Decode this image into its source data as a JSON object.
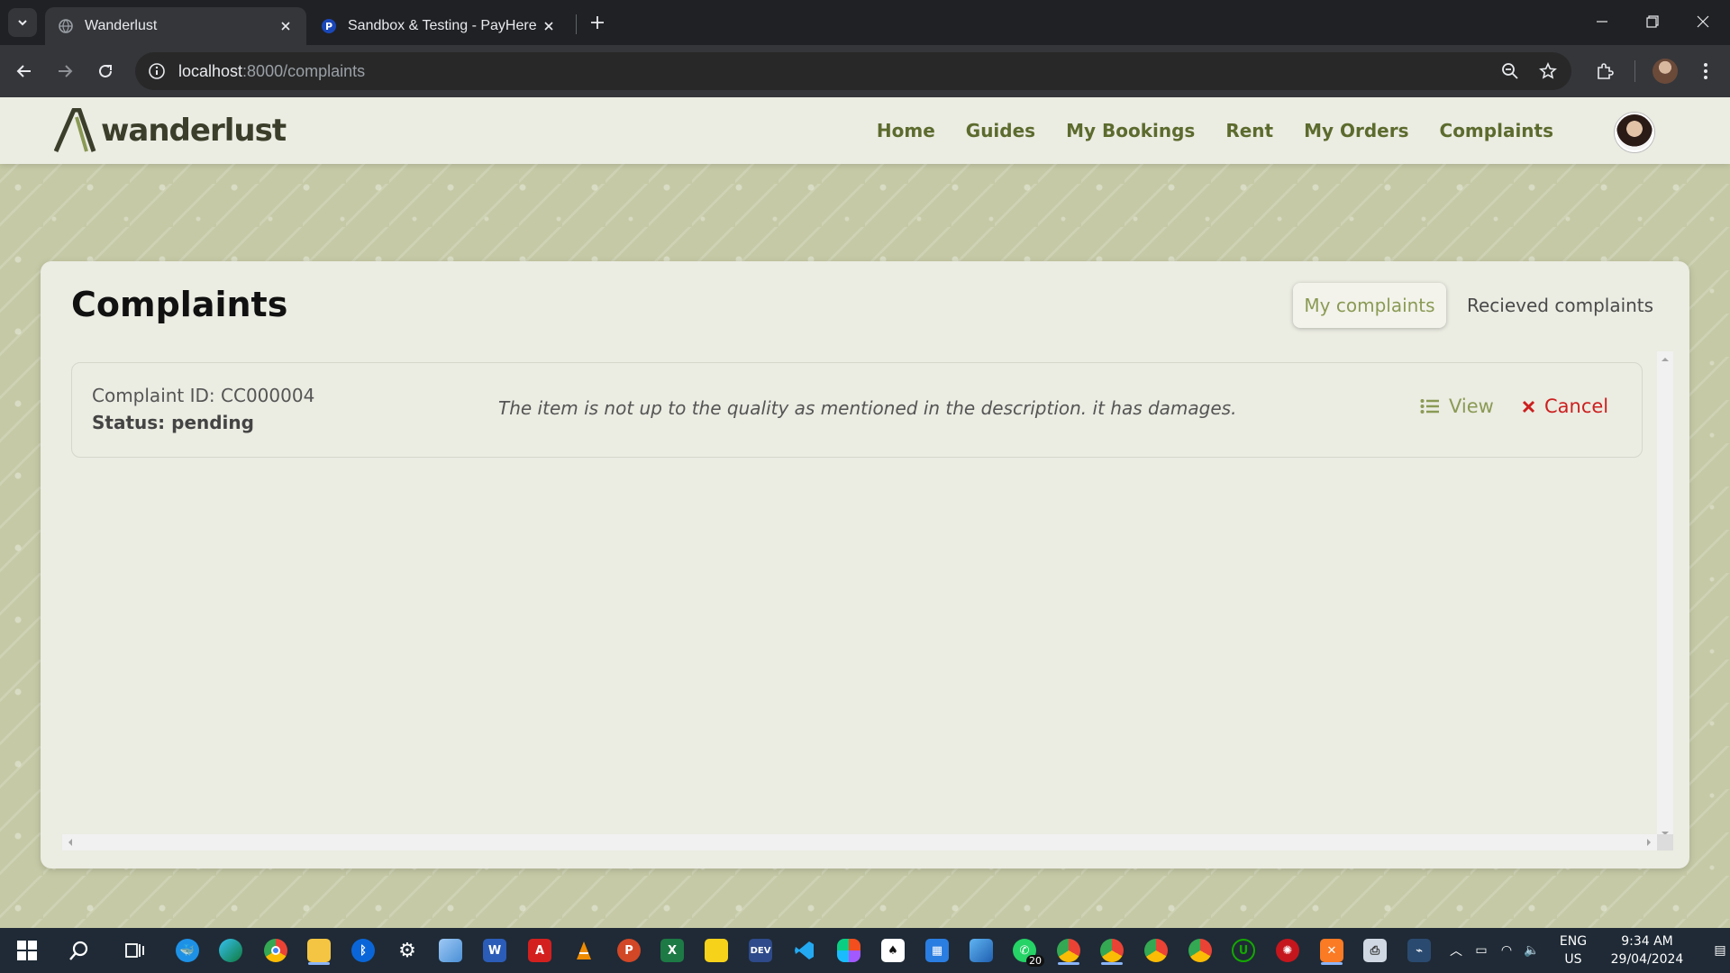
{
  "browser": {
    "tabs": [
      {
        "title": "Wanderlust",
        "active": true
      },
      {
        "title": "Sandbox & Testing - PayHere -",
        "active": false
      }
    ],
    "url_host": "localhost",
    "url_path": ":8000/complaints"
  },
  "navbar": {
    "logo_text": "wanderlust",
    "links": [
      "Home",
      "Guides",
      "My Bookings",
      "Rent",
      "My Orders",
      "Complaints"
    ]
  },
  "complaints_page": {
    "title": "Complaints",
    "tab_my": "My complaints",
    "tab_received": "Recieved complaints",
    "items": [
      {
        "id_text": "Complaint ID: CC000004",
        "status_text": "Status: pending",
        "description": "The item is not up to the quality as mentioned in the description. it has damages.",
        "view_label": "View",
        "cancel_label": "Cancel"
      }
    ]
  },
  "taskbar": {
    "whatsapp_badge": "20",
    "lang_top": "ENG",
    "lang_bottom": "US",
    "time": "9:34 AM",
    "date": "29/04/2024"
  },
  "colors": {
    "accent": "#8a9a55",
    "nav_text": "#5c6b2e",
    "danger": "#cc1f1f",
    "page_bg": "#c5c9a5",
    "card_bg": "#ebece2"
  }
}
